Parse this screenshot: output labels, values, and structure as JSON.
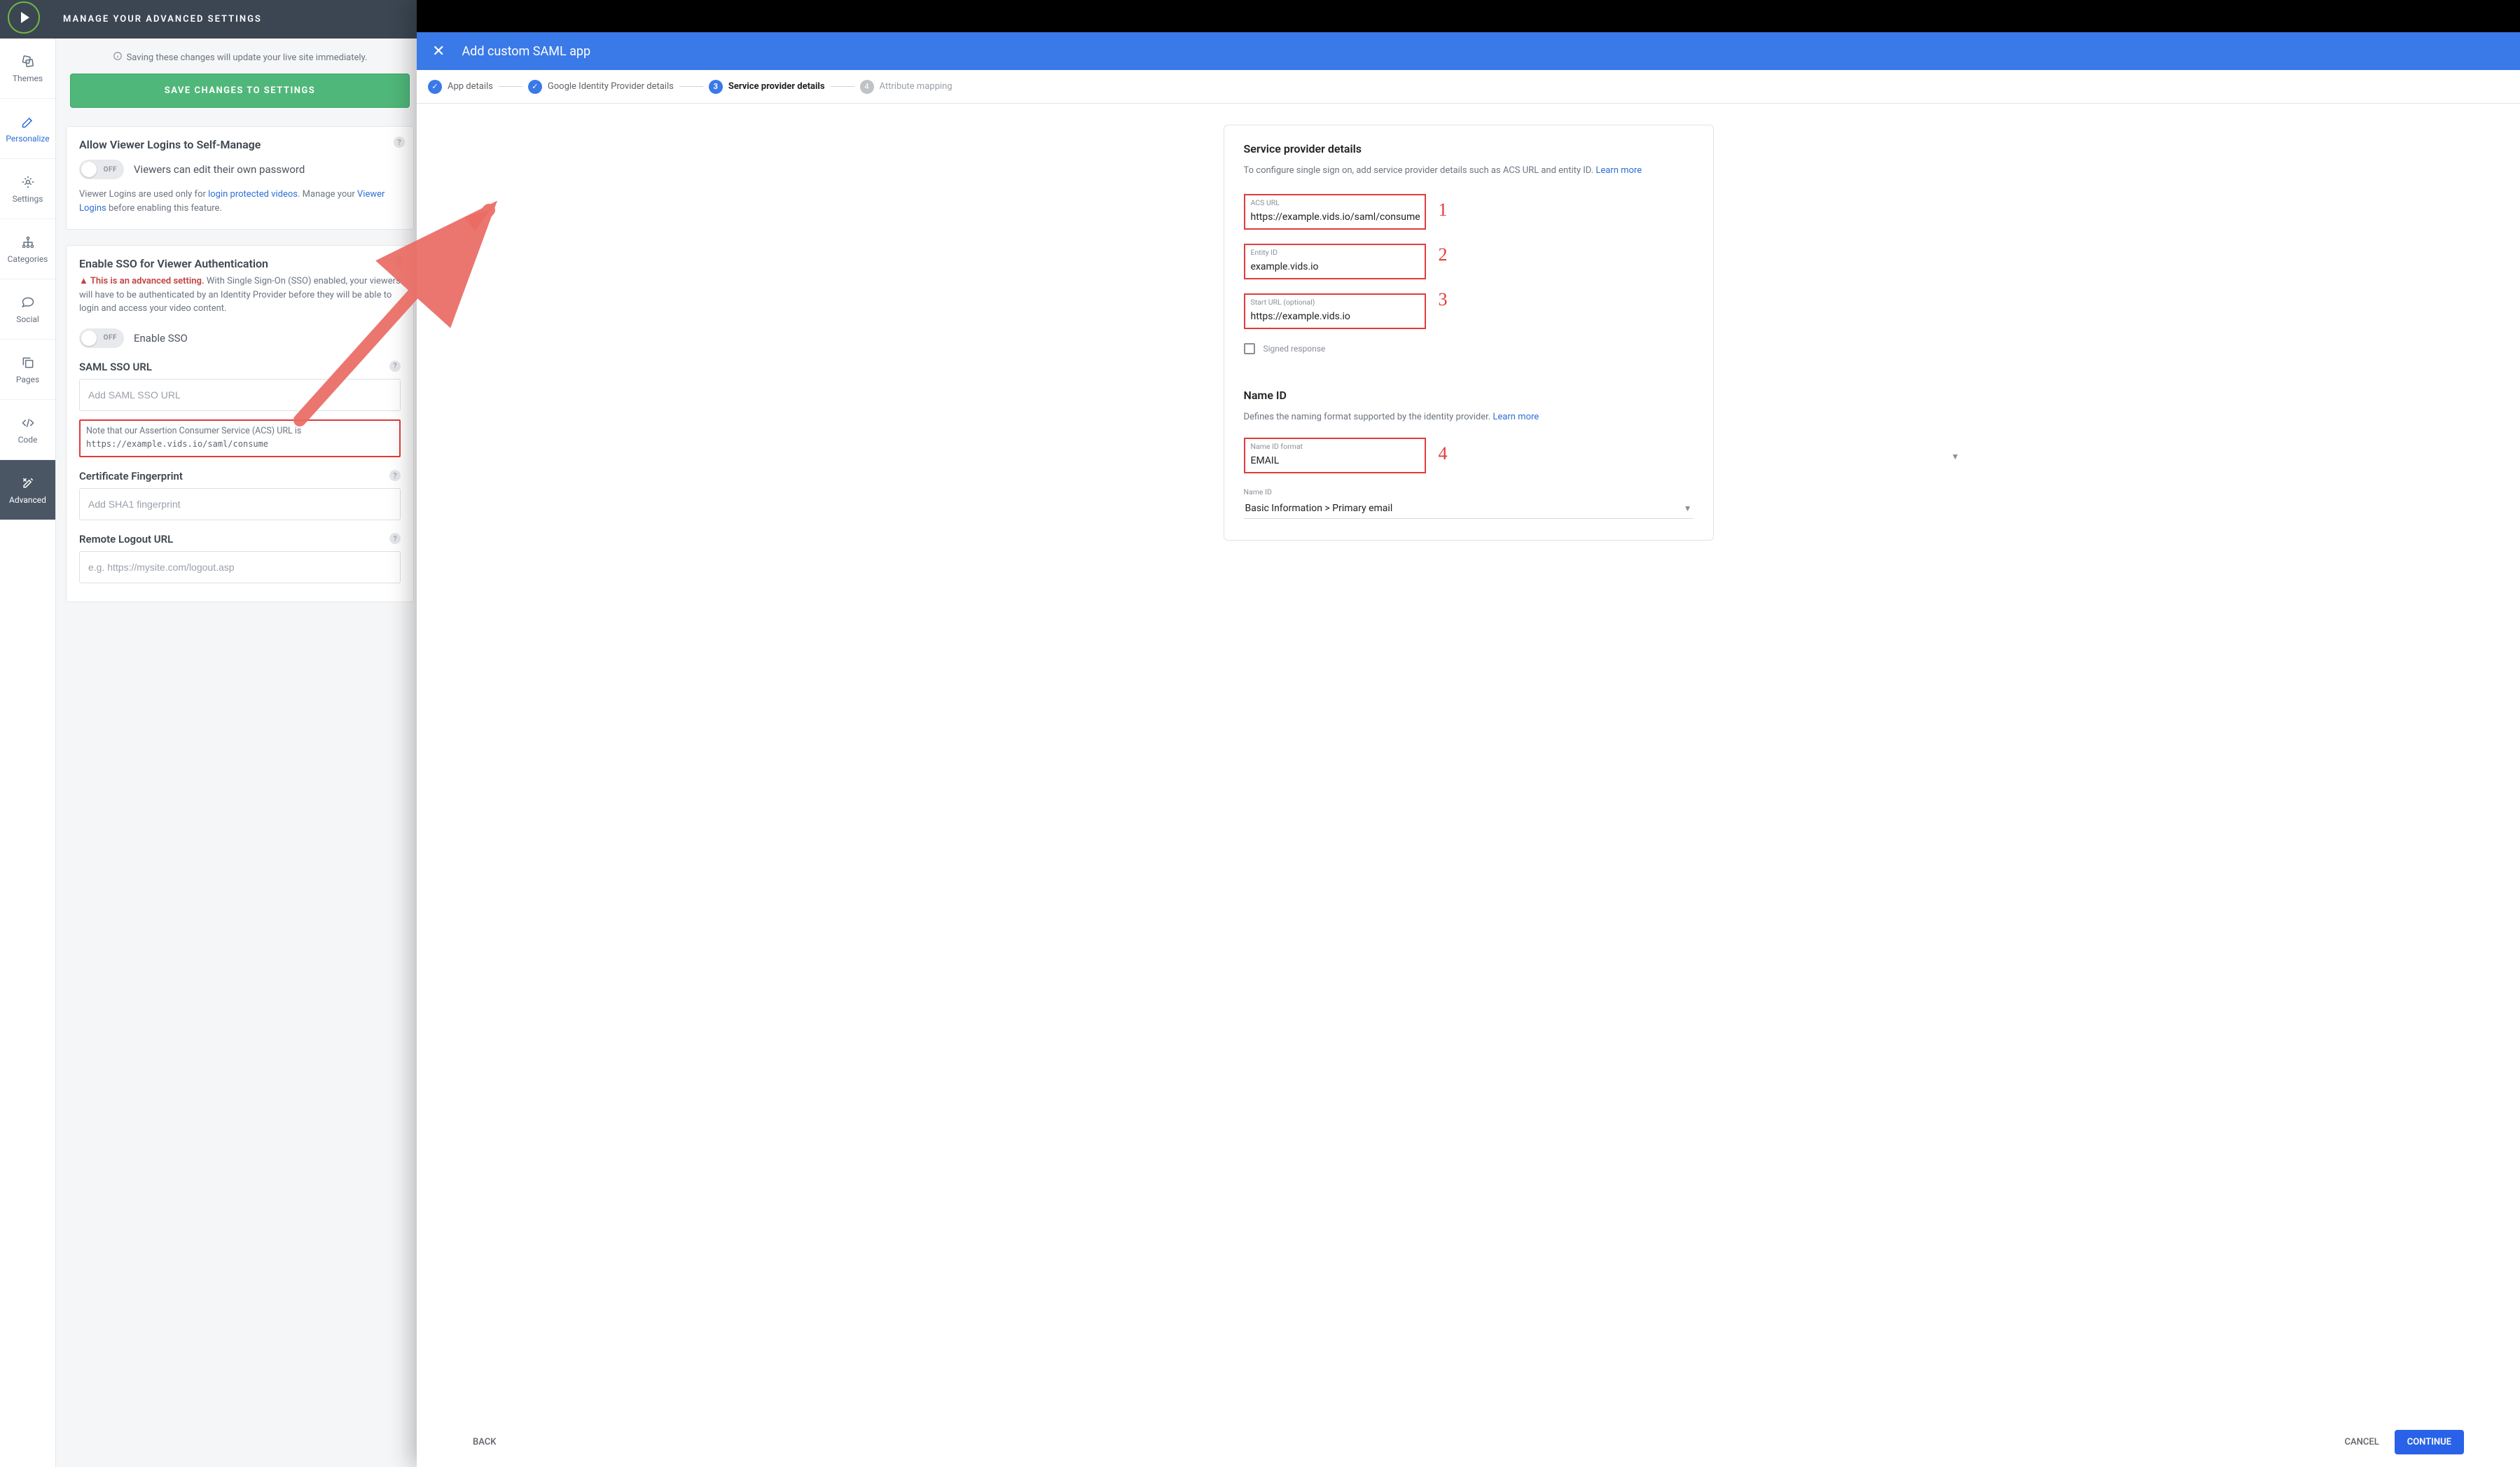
{
  "left": {
    "header_title": "MANAGE YOUR ADVANCED SETTINGS",
    "sidebar": {
      "items": [
        {
          "label": "Themes"
        },
        {
          "label": "Personalize"
        },
        {
          "label": "Settings"
        },
        {
          "label": "Categories"
        },
        {
          "label": "Social"
        },
        {
          "label": "Pages"
        },
        {
          "label": "Code"
        },
        {
          "label": "Advanced"
        }
      ]
    },
    "info_banner": "Saving these changes will update your live site immediately.",
    "save_button": "SAVE CHANGES TO SETTINGS",
    "card_selfmanage": {
      "title": "Allow Viewer Logins to Self-Manage",
      "toggle_state": "OFF",
      "toggle_desc": "Viewers can edit their own password",
      "note_prefix": "Viewer Logins are used only for ",
      "note_link1": "login protected videos",
      "note_mid": ". Manage your ",
      "note_link2": "Viewer Logins",
      "note_suffix": " before enabling this feature."
    },
    "card_sso": {
      "title": "Enable SSO for Viewer Authentication",
      "warn_label": "This is an advanced setting.",
      "warn_text": " With Single Sign-On (SSO) enabled, your viewers will have to be authenticated by an Identity Provider before they will be able to login and access your video content.",
      "toggle_state": "OFF",
      "toggle_desc": "Enable SSO",
      "saml_url_label": "SAML SSO URL",
      "saml_url_placeholder": "Add SAML SSO URL",
      "acs_note_prefix": "Note that our Assertion Consumer Service (ACS) URL is",
      "acs_url_code": "https://example.vids.io/saml/consume",
      "cert_label": "Certificate Fingerprint",
      "cert_placeholder": "Add SHA1 fingerprint",
      "logout_label": "Remote Logout URL",
      "logout_placeholder": "e.g. https://mysite.com/logout.asp"
    }
  },
  "right": {
    "modal_title": "Add custom SAML app",
    "steps": [
      {
        "label": "App details"
      },
      {
        "label": "Google Identity Provider details"
      },
      {
        "label": "Service provider details"
      },
      {
        "label": "Attribute mapping"
      }
    ],
    "step_numbers": {
      "three": "3",
      "four": "4"
    },
    "card": {
      "title": "Service provider details",
      "subtitle_prefix": "To configure single sign on, add service provider details such as ACS URL and entity ID. ",
      "learn_more": "Learn more",
      "fields": {
        "acs": {
          "label": "ACS URL",
          "value": "https://example.vids.io/saml/consume"
        },
        "entity": {
          "label": "Entity ID",
          "value": "example.vids.io"
        },
        "start": {
          "label": "Start URL (optional)",
          "value": "https://example.vids.io"
        }
      },
      "signed_response": "Signed response",
      "nameid_section_title": "Name ID",
      "nameid_section_sub_prefix": "Defines the naming format supported by the identity provider. ",
      "nameid_format": {
        "label": "Name ID format",
        "value": "EMAIL"
      },
      "nameid_select": {
        "label": "Name ID",
        "value": "Basic Information > Primary email"
      }
    },
    "footer": {
      "back": "BACK",
      "cancel": "CANCEL",
      "continue": "CONTINUE"
    },
    "annotations": {
      "a1": "1",
      "a2": "2",
      "a3": "3",
      "a4": "4"
    }
  }
}
